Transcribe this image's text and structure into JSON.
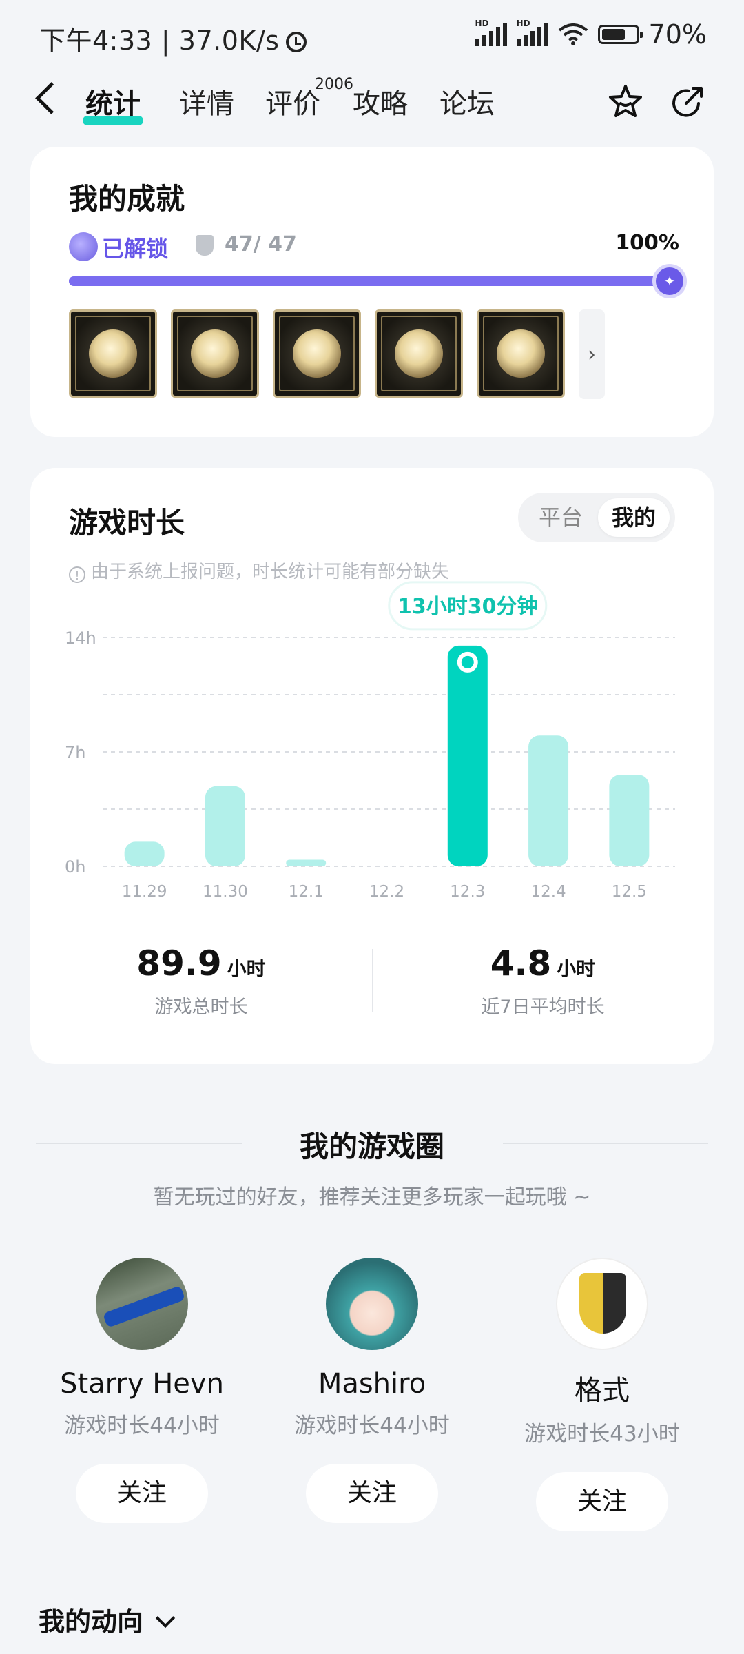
{
  "status_bar": {
    "time_speed": "下午4:33 | 37.0K/s",
    "battery_pct": "70%",
    "battery_level": 0.7,
    "signal_label": "HD"
  },
  "nav": {
    "tabs": [
      {
        "label": "统计",
        "active": true
      },
      {
        "label": "详情"
      },
      {
        "label": "评价"
      },
      {
        "label": "攻略"
      },
      {
        "label": "论坛"
      }
    ],
    "review_count": "2006",
    "icons": [
      "back-icon",
      "star-icon",
      "share-icon"
    ]
  },
  "achievements": {
    "title": "我的成就",
    "unlocked_label": "已解锁",
    "count": "47/ 47",
    "percent": "100%",
    "progress": 1.0,
    "badge_icons": [
      "achievement-badge-icon",
      "achievement-badge-icon",
      "achievement-badge-icon",
      "achievement-badge-icon",
      "achievement-badge-icon"
    ]
  },
  "playtime": {
    "title": "游戏时长",
    "toggle": [
      "平台",
      "我的"
    ],
    "toggle_selected": "我的",
    "notice": "由于系统上报问题，时长统计可能有部分缺失",
    "tooltip": "13小时30分钟",
    "total_value": "89.9",
    "total_unit": "小时",
    "total_label": "游戏总时长",
    "avg_value": "4.8",
    "avg_unit": "小时",
    "avg_label": "近7日平均时长"
  },
  "chart_data": {
    "type": "bar",
    "categories": [
      "11.29",
      "11.30",
      "12.1",
      "12.2",
      "12.3",
      "12.4",
      "12.5"
    ],
    "values": [
      1.5,
      4.9,
      0.4,
      0,
      13.5,
      8.0,
      5.6
    ],
    "highlight_index": 4,
    "ylim": [
      0,
      14
    ],
    "yticks": [
      "0h",
      "7h",
      "14h"
    ],
    "ytick_values": [
      0,
      7,
      14
    ],
    "grid": true,
    "colors": {
      "bar": "#b2f0ea",
      "highlight": "#00d4bf"
    }
  },
  "game_circle": {
    "title": "我的游戏圈",
    "subtitle": "暂无玩过的好友，推荐关注更多玩家一起玩哦 ~",
    "friends": [
      {
        "name": "Starry Hevn",
        "time": "游戏时长44小时",
        "follow": "关注"
      },
      {
        "name": "Mashiro",
        "time": "游戏时长44小时",
        "follow": "关注"
      },
      {
        "name": "格式",
        "time": "游戏时长43小时",
        "follow": "关注"
      }
    ]
  },
  "footer": {
    "dynamics_label": "我的动向"
  }
}
